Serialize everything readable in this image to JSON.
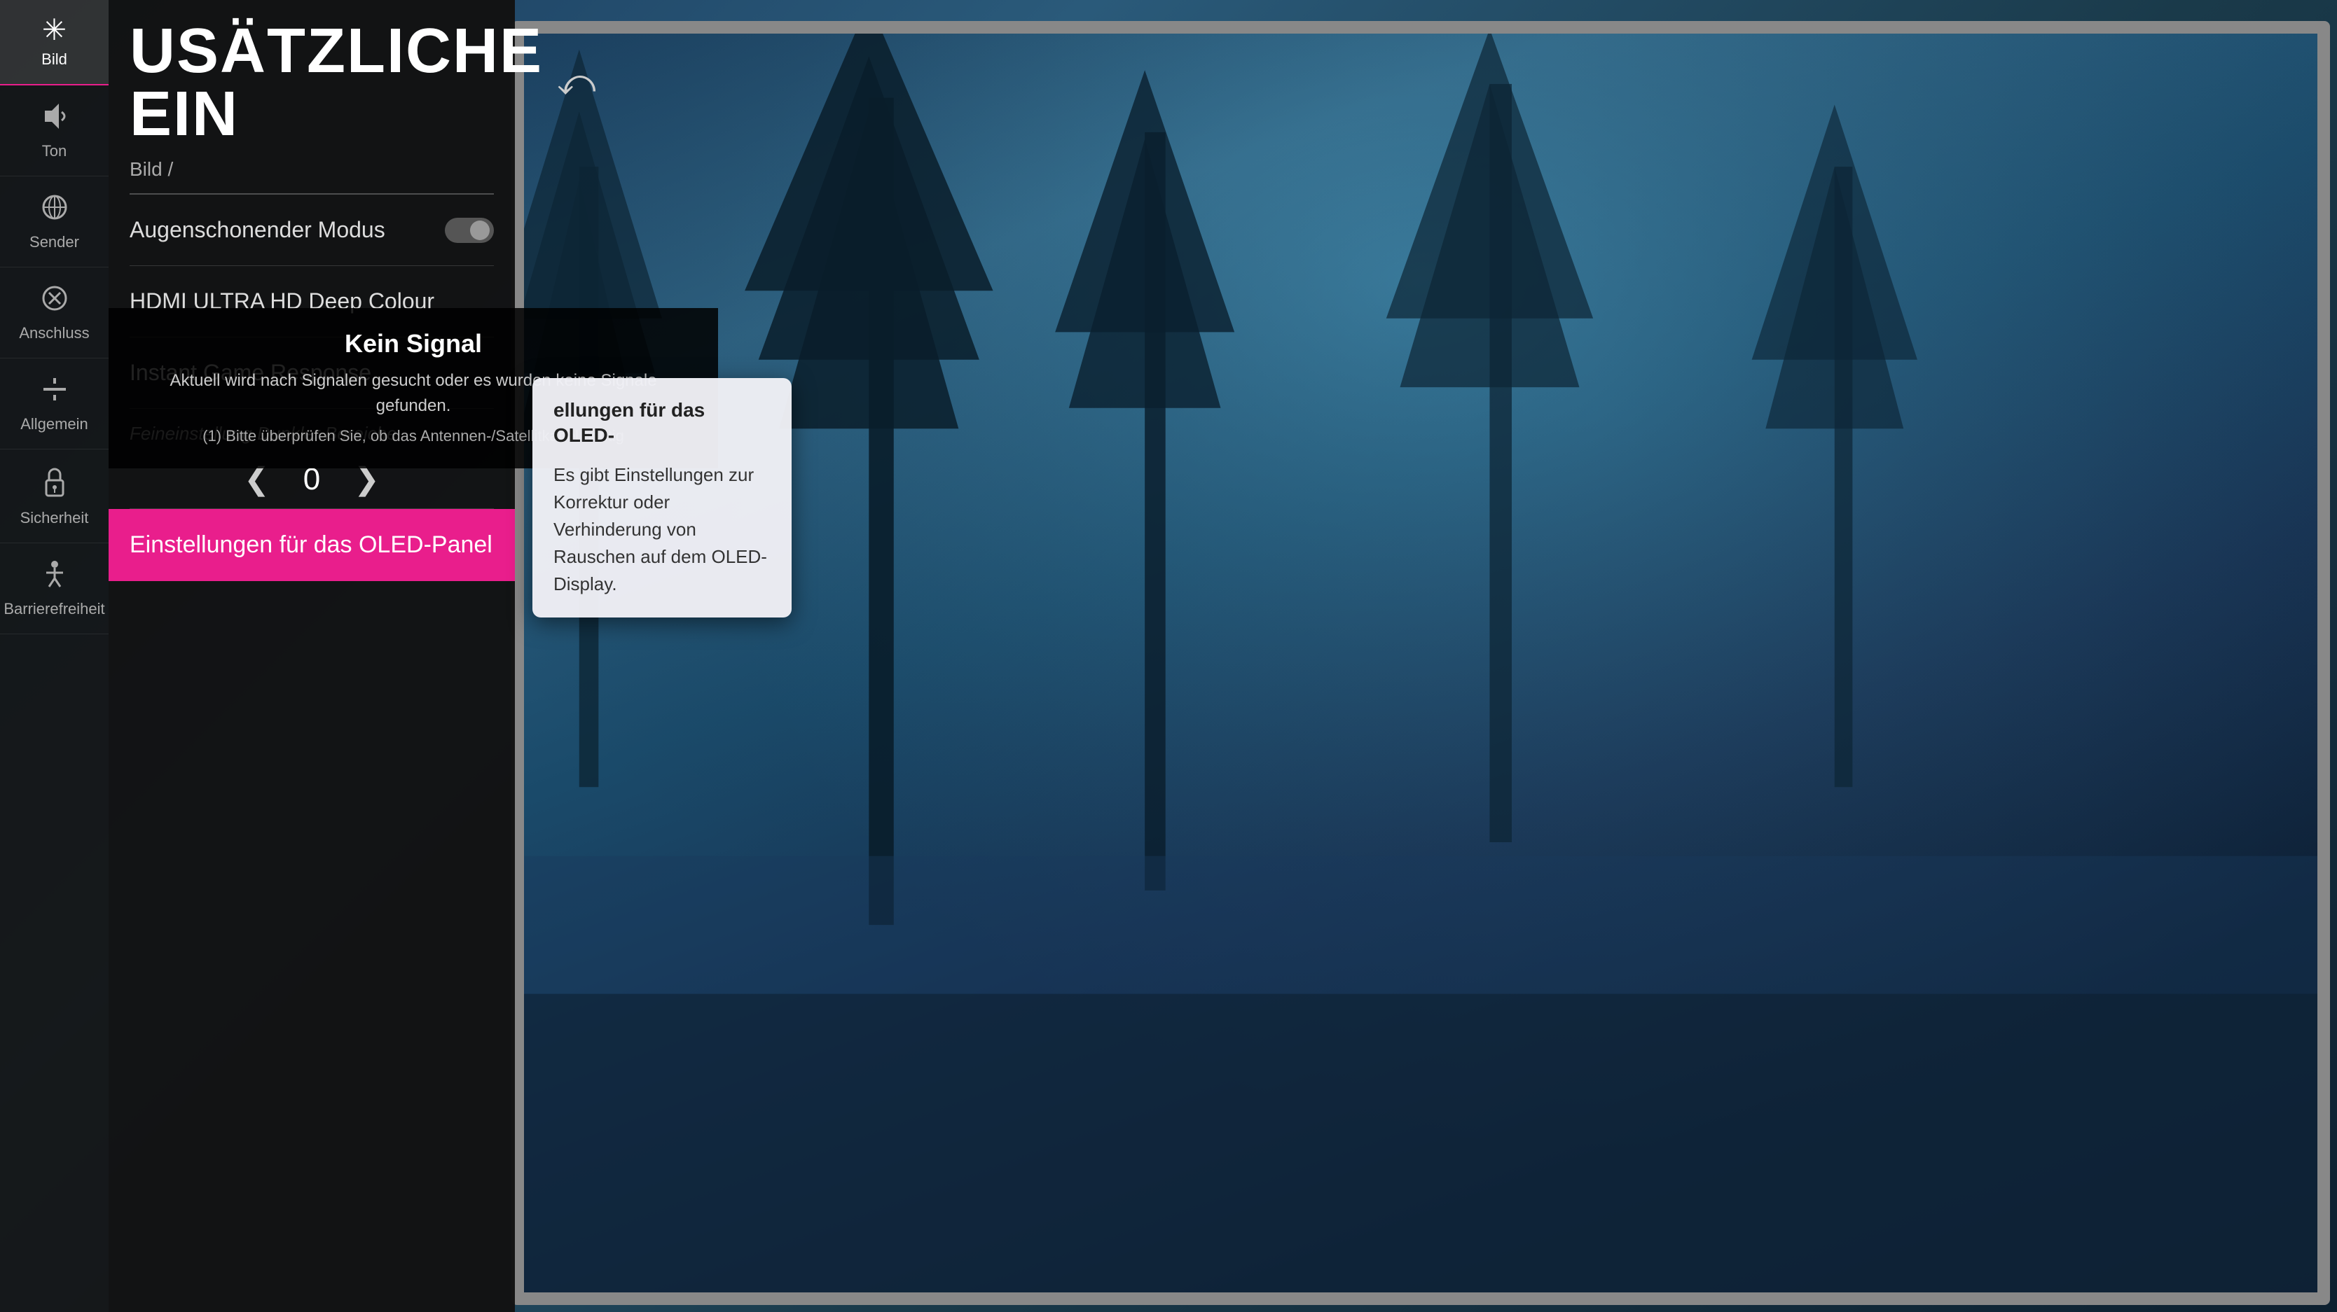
{
  "bg": {
    "color_start": "#1b4060",
    "color_end": "#0a1828"
  },
  "sidebar": {
    "items": [
      {
        "id": "bild",
        "label": "Bild",
        "icon": "✳"
      },
      {
        "id": "ton",
        "label": "Ton",
        "icon": "🔈"
      },
      {
        "id": "sender",
        "label": "Sender",
        "icon": "⚓"
      },
      {
        "id": "anschluss",
        "label": "Anschluss",
        "icon": "⚽"
      },
      {
        "id": "allgemein",
        "label": "Allgemein",
        "icon": "🔧"
      },
      {
        "id": "sicherheit",
        "label": "Sicherheit",
        "icon": "🔒"
      },
      {
        "id": "barrierefreiheit",
        "label": "Barrierefreiheit",
        "icon": "♿"
      }
    ]
  },
  "header": {
    "title": "USÄTZLICHE EIN",
    "back_label": "⤺"
  },
  "breadcrumb": {
    "text": "Bild /"
  },
  "menu": {
    "items": [
      {
        "id": "augenschonender-modus",
        "label": "Augenschonender Modus",
        "has_toggle": true,
        "toggle_state": "off"
      },
      {
        "id": "hdmi-ultra",
        "label": "HDMI ULTRA HD Deep Colour",
        "has_toggle": false
      },
      {
        "id": "instant-game",
        "label": "Instant Game Response",
        "has_toggle": false
      }
    ],
    "feineinstellung_label": "Feineinstellung Dunkler Bereiche",
    "slider_value": "0",
    "slider_left": "❮",
    "slider_right": "❯",
    "highlighted_item": {
      "label": "Einstellungen für das OLED-Panel"
    }
  },
  "signal": {
    "title": "Kein Signal",
    "line1": "Aktuell wird nach Signalen gesucht oder es wurden keine Signale gefunden.",
    "line2": "(1) Bitte überprüfen Sie, ob das Antennen-/Satellitkabel richtig"
  },
  "tooltip": {
    "title": "ellungen für das OLED-",
    "body": "Es gibt Einstellungen zur Korrektur oder Verhinderung von Rauschen auf dem OLED-Display."
  }
}
